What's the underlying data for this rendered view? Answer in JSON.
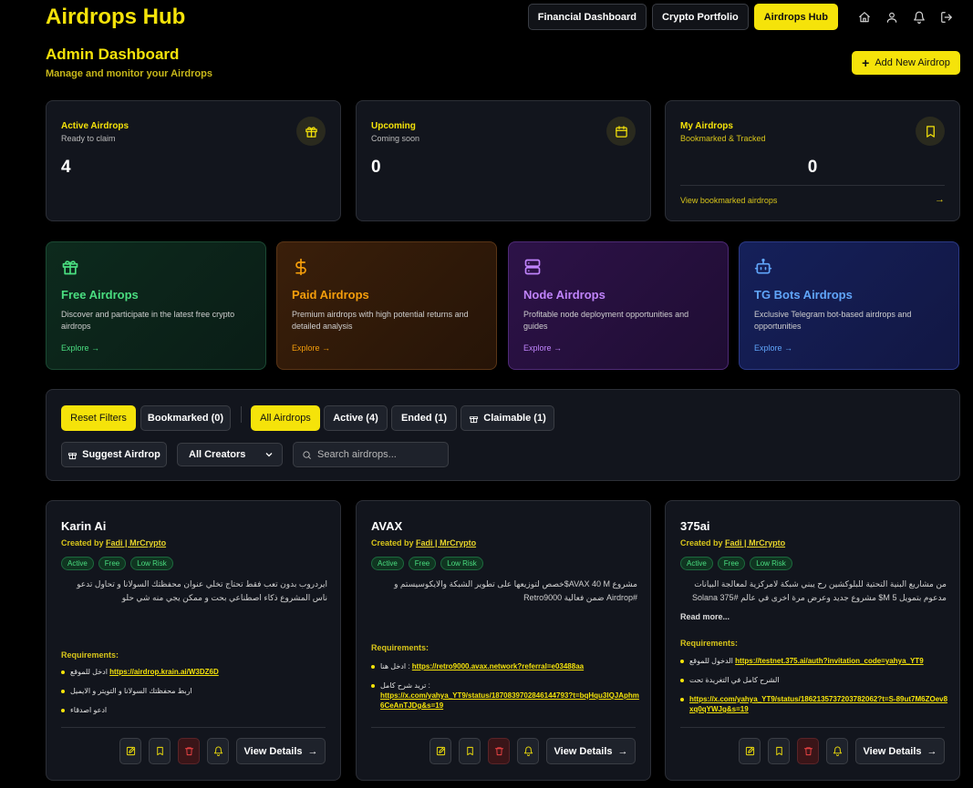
{
  "header": {
    "brand": "Airdrops Hub",
    "nav": [
      {
        "label": "Financial Dashboard"
      },
      {
        "label": "Crypto Portfolio"
      },
      {
        "label": "Airdrops Hub"
      }
    ],
    "icons": [
      "home-icon",
      "user-icon",
      "bell-icon",
      "logout-icon"
    ]
  },
  "admin": {
    "title": "Admin Dashboard",
    "subtitle": "Manage and monitor your Airdrops",
    "add_label": "Add New Airdrop"
  },
  "stats": {
    "active": {
      "title": "Active Airdrops",
      "sub": "Ready to claim",
      "value": "4",
      "icon": "gift-icon"
    },
    "upcoming": {
      "title": "Upcoming",
      "sub": "Coming soon",
      "value": "0",
      "icon": "calendar-icon"
    },
    "mine": {
      "title": "My Airdrops",
      "sub": "Bookmarked & Tracked",
      "value": "0",
      "link": "View bookmarked airdrops",
      "arrow": "→",
      "icon": "bookmark-icon"
    }
  },
  "categories": {
    "free": {
      "title": "Free Airdrops",
      "desc": "Discover and participate in the latest free crypto airdrops",
      "explore": "Explore →",
      "color": "#4ade80"
    },
    "paid": {
      "title": "Paid Airdrops",
      "desc": "Premium airdrops with high potential returns and detailed analysis",
      "explore": "Explore →",
      "color": "#f59e0b"
    },
    "node": {
      "title": "Node Airdrops",
      "desc": "Profitable node deployment opportunities and guides",
      "explore": "Explore →",
      "color": "#c084fc"
    },
    "tg": {
      "title": "TG Bots Airdrops",
      "desc": "Exclusive Telegram bot-based airdrops and opportunities",
      "explore": "Explore →",
      "color": "#60a5fa"
    }
  },
  "filters": {
    "reset": "Reset Filters",
    "bookmarked": "Bookmarked (0)",
    "all": "All Airdrops",
    "active": "Active (4)",
    "ended": "Ended (1)",
    "claimable": "Claimable (1)",
    "suggest": "Suggest Airdrop",
    "creators_selected": "All Creators",
    "search_placeholder": "Search airdrops..."
  },
  "cards": [
    {
      "title": "Karin Ai",
      "by_prefix": "Created by",
      "creator": "Fadi | MrCrypto",
      "tags": [
        "Active",
        "Free",
        "Low Risk"
      ],
      "desc": "ايردروب بدون تعب فقط تحتاج تخلي عنوان محفظتك السولانا و تحاول تدعو ناس المشروع ذكاء اصطناعي بحت و ممكن يجي منه شي حلو",
      "req_label": "Requirements:",
      "reqs": [
        {
          "text": "ادخل للموقع",
          "link": "https://airdrop.krain.ai/W3DZ6D"
        },
        {
          "text": "اربط محفظتك السولانا و التويتر و الايميل",
          "link": ""
        },
        {
          "text": "ادعو اصدقاء",
          "link": ""
        }
      ],
      "view": "View Details",
      "arrow": "→"
    },
    {
      "title": "AVAX",
      "by_prefix": "Created by",
      "creator": "Fadi | MrCrypto",
      "tags": [
        "Active",
        "Free",
        "Low Risk"
      ],
      "desc": "مشروع AVAX 40 M$خصص لتوزيعها على تطوير الشبكة والايكوسيستم و #Airdrop ضمن فعالية Retro9000",
      "req_label": "Requirements:",
      "reqs": [
        {
          "text": "ادخل هنا :",
          "link": "https://retro9000.avax.network?referral=e03488aa"
        },
        {
          "text": "تريد شرح كامل :",
          "link": "https://x.com/yahya_YT9/status/1870839702846144793?t=bqHqu3IQJAphm6CeAnTJDg&s=19"
        }
      ],
      "view": "View Details",
      "arrow": "→"
    },
    {
      "title": "375ai",
      "by_prefix": "Created by",
      "creator": "Fadi | MrCrypto",
      "tags": [
        "Active",
        "Free",
        "Low Risk"
      ],
      "desc": "من مشاريع البنية التحتية للبلوكشين رح يبني شبكة لامركزية لمعالجة البيانات مدعوم بتمويل 5 M$ مشروع جديد وعرض مرة اخرى في عالم #Solana 375 ai$",
      "more": "Read more...",
      "req_label": "Requirements:",
      "reqs": [
        {
          "text": "الدخول للموقع",
          "link": "https://testnet.375.ai/auth?invitation_code=yahya_YT9"
        },
        {
          "text": "الشرح كامل في التغريدة تحت",
          "link": ""
        },
        {
          "text": "",
          "link": "https://x.com/yahya_YT9/status/1862135737203782062?t=S-89ut7M6ZOev8xq0qYWJg&s=19"
        }
      ],
      "view": "View Details",
      "arrow": "→"
    }
  ]
}
